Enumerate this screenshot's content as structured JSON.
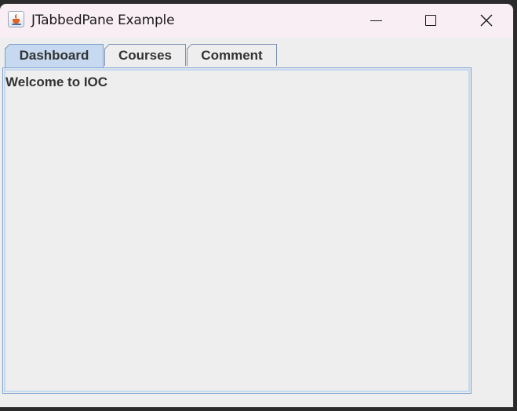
{
  "window": {
    "title": "JTabbedPane Example",
    "icon": "java-cup-icon"
  },
  "controls": {
    "minimize": "minimize-icon",
    "maximize": "maximize-icon",
    "close": "close-icon"
  },
  "tabs": [
    {
      "label": "Dashboard",
      "selected": true
    },
    {
      "label": "Courses",
      "selected": false
    },
    {
      "label": "Comment",
      "selected": false
    }
  ],
  "content": {
    "welcome_text": "Welcome to IOC"
  },
  "colors": {
    "selected_tab": "#c6d9f0",
    "tab_border": "#7a9fd0",
    "background": "#eeeeee",
    "titlebar": "#f8eef4"
  }
}
